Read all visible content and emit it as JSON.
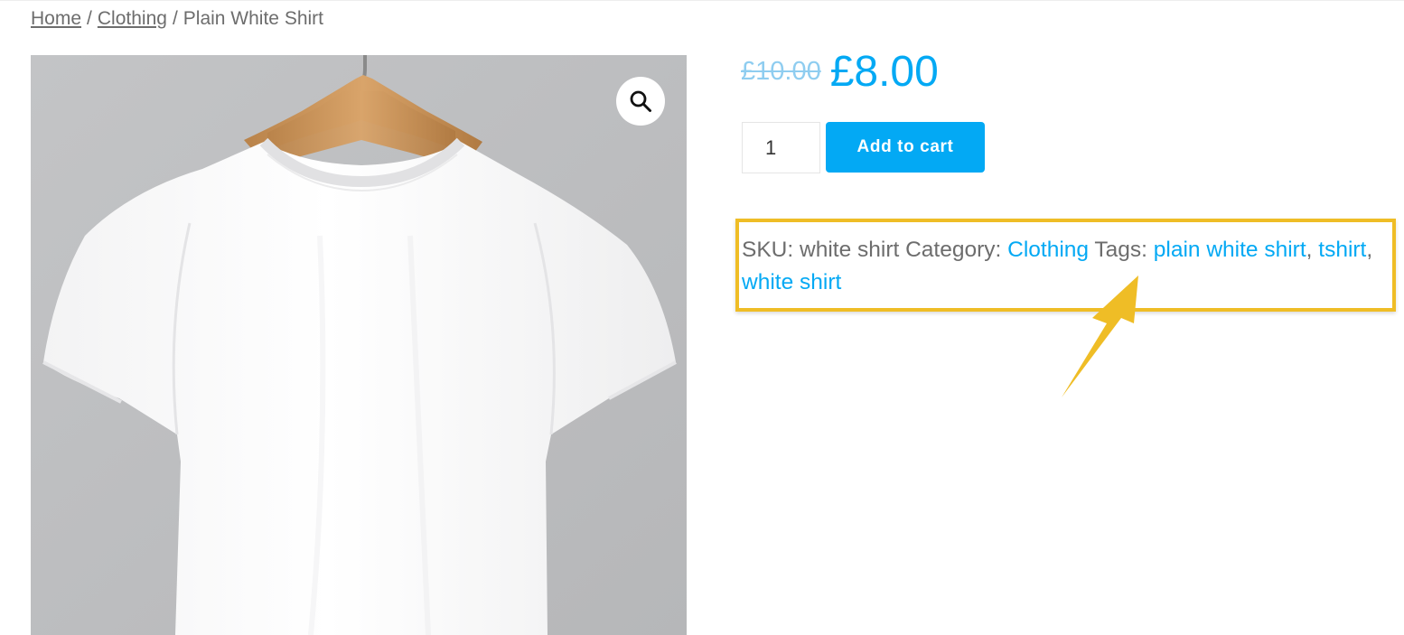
{
  "breadcrumb": {
    "items": [
      {
        "label": "Home"
      },
      {
        "label": "Clothing"
      }
    ],
    "separator": "/",
    "current": "Plain White Shirt"
  },
  "gallery": {
    "alt": "Plain white t-shirt on a wooden hanger",
    "zoom_icon": "search-icon"
  },
  "price": {
    "regular": "£10.00",
    "sale": "£8.00"
  },
  "cart": {
    "quantity": "1",
    "add_label": "Add to cart"
  },
  "meta": {
    "sku_label": "SKU:",
    "sku_value": "white shirt",
    "category_label": "Category:",
    "category": "Clothing",
    "tags_label": "Tags:",
    "tags": [
      "plain white shirt",
      "tshirt",
      "white shirt"
    ]
  },
  "colors": {
    "accent": "#03a9f4",
    "highlight": "#efbd26",
    "text": "#6d6d6d"
  }
}
